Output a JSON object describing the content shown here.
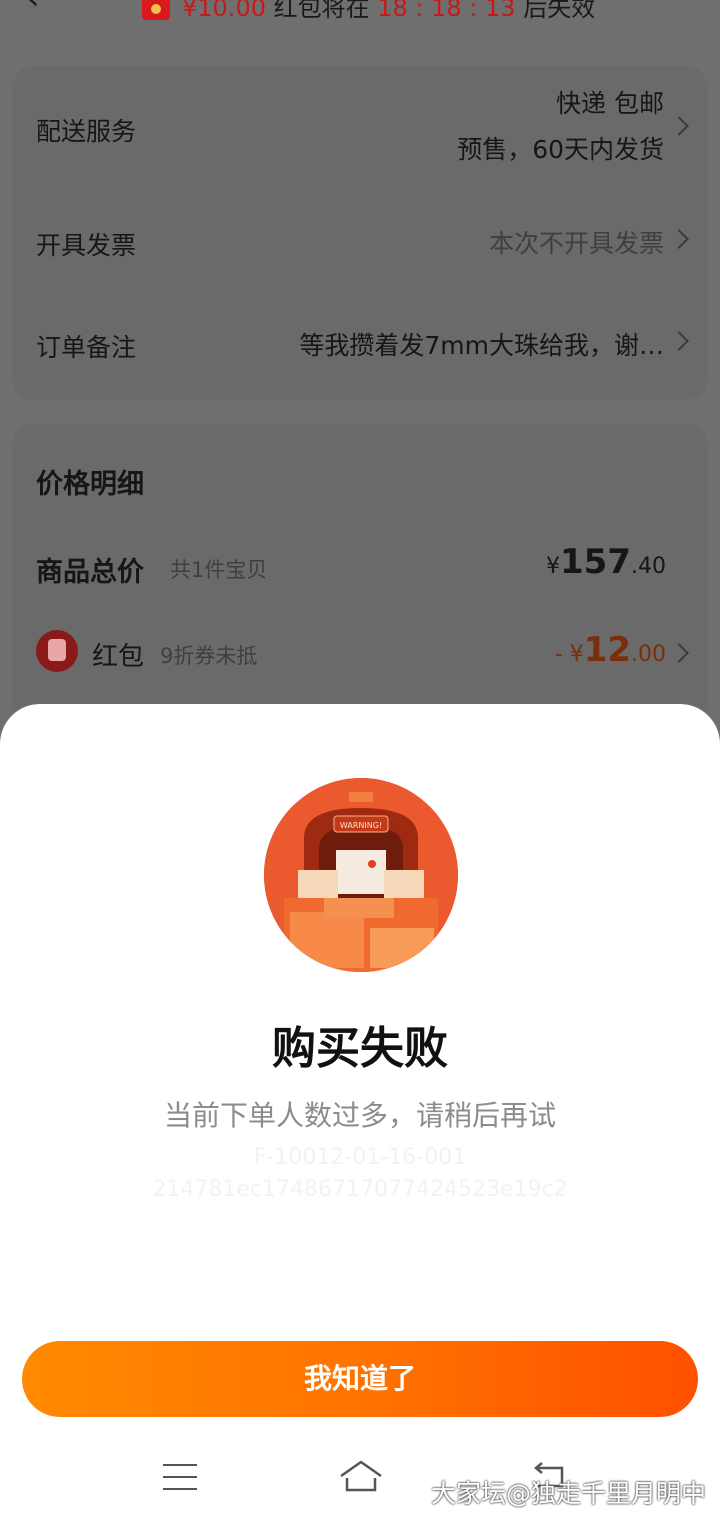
{
  "header": {
    "amount": "¥10.00",
    "text_before_timer": "红包将在",
    "timer": "18 : 18 : 13",
    "text_after_timer": "后失效"
  },
  "order_options": {
    "delivery": {
      "label": "配送服务",
      "line1": "快递 包邮",
      "line2": "预售，60天内发货"
    },
    "invoice": {
      "label": "开具发票",
      "value": "本次不开具发票"
    },
    "note": {
      "label": "订单备注",
      "value": "等我攒着发7mm大珠给我，谢…"
    }
  },
  "price_detail": {
    "title": "价格明细",
    "goods_total": {
      "label": "商品总价",
      "sub": "共1件宝贝",
      "currency": "¥",
      "integer": "157",
      "decimal": ".40"
    },
    "red_packet": {
      "label": "红包",
      "sub": "9折券未抵",
      "prefix": "- ¥",
      "integer": "12",
      "decimal": ".00"
    }
  },
  "dialog": {
    "title": "购买失败",
    "message": "当前下单人数过多，请稍后再试",
    "error_code": "F-10012-01-16-001",
    "trace_id": "214781ec17486717077424523e19c2",
    "button_label": "我知道了",
    "illustration_sign": "WARNING!"
  },
  "watermark": "大家坛@独走千里月明中",
  "colors": {
    "accent_orange": "#ff5000",
    "accent_orange_light": "#ff8a00",
    "illustration_red": "#e9552d",
    "timer_red": "#c61a1a"
  }
}
